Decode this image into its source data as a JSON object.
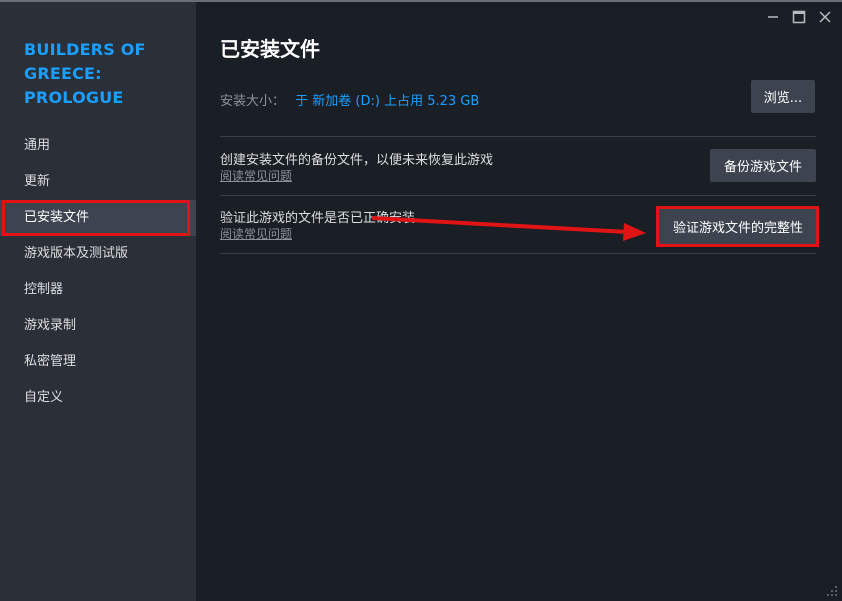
{
  "sidebar": {
    "game_title": "BUILDERS OF GREECE: PROLOGUE",
    "items": [
      {
        "label": "通用",
        "active": false
      },
      {
        "label": "更新",
        "active": false
      },
      {
        "label": "已安装文件",
        "active": true
      },
      {
        "label": "游戏版本及测试版",
        "active": false
      },
      {
        "label": "控制器",
        "active": false
      },
      {
        "label": "游戏录制",
        "active": false
      },
      {
        "label": "私密管理",
        "active": false
      },
      {
        "label": "自定义",
        "active": false
      }
    ]
  },
  "window_controls": {
    "minimize": "minimize-icon",
    "maximize": "maximize-icon",
    "close": "close-icon"
  },
  "main": {
    "title": "已安装文件",
    "install_size_label": "安装大小：",
    "install_size_value": "于 新加卷 (D:) 上占用 5.23 GB",
    "browse_button": "浏览...",
    "backup": {
      "text": "创建安装文件的备份文件，以便未来恢复此游戏",
      "link": "阅读常见问题",
      "button": "备份游戏文件"
    },
    "verify": {
      "text": "验证此游戏的文件是否已正确安装",
      "link": "阅读常见问题",
      "button": "验证游戏文件的完整性"
    }
  },
  "colors": {
    "accent": "#1a9fff",
    "highlight": "#e01414",
    "sidebar_bg": "#2b2f37",
    "main_bg": "#1a1e25"
  }
}
